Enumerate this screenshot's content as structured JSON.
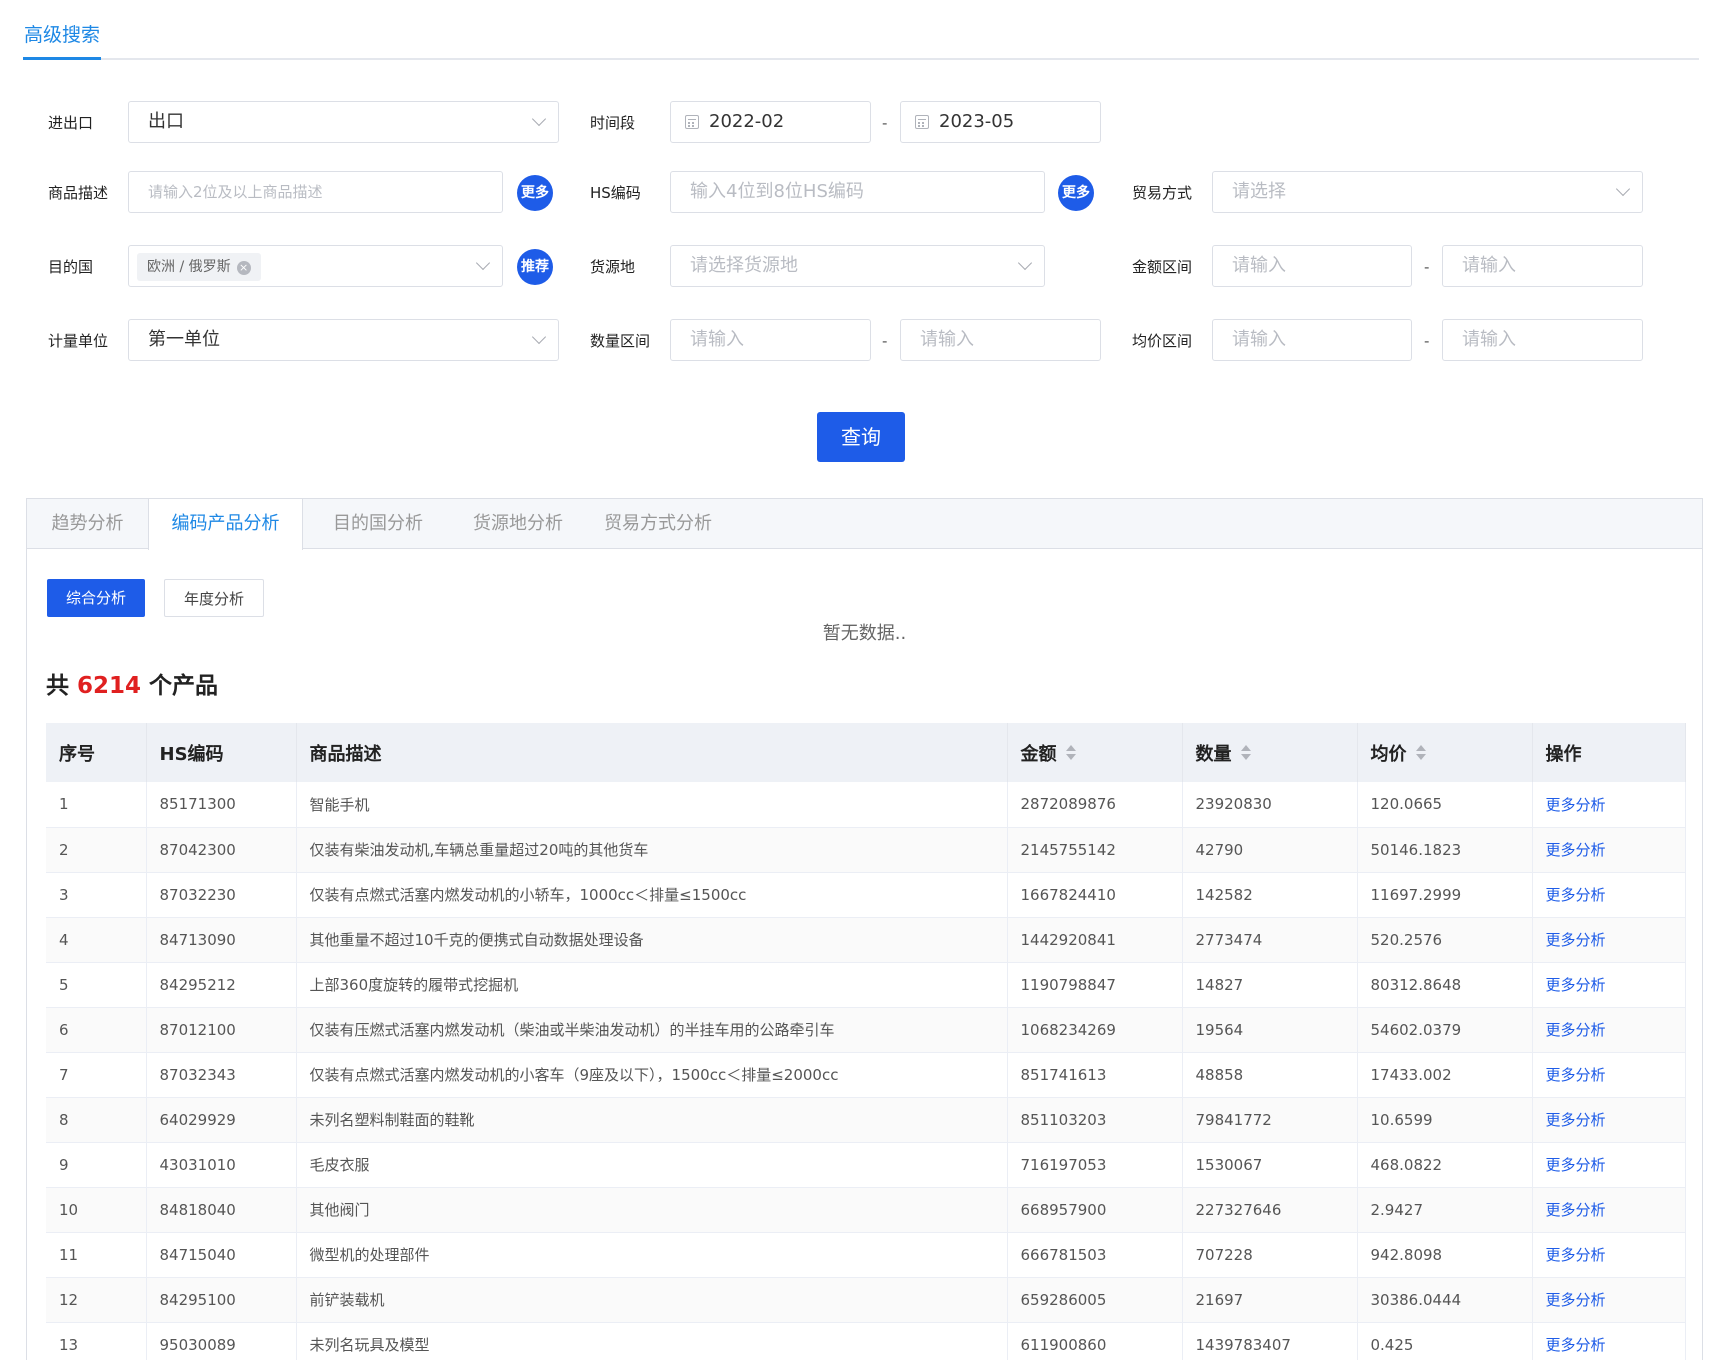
{
  "top_tab": "高级搜索",
  "form": {
    "import_export": {
      "label": "进出口",
      "value": "出口"
    },
    "period": {
      "label": "时间段",
      "start": "2022-02",
      "end": "2023-05",
      "sep": "-"
    },
    "product_desc": {
      "label": "商品描述",
      "placeholder": "请输入2位及以上商品描述",
      "more": "更多"
    },
    "hs_code": {
      "label": "HS编码",
      "placeholder": "输入4位到8位HS编码",
      "more": "更多"
    },
    "trade_mode": {
      "label": "贸易方式",
      "placeholder": "请选择"
    },
    "destination": {
      "label": "目的国",
      "tag": "欧洲 / 俄罗斯",
      "recommend": "推荐"
    },
    "origin": {
      "label": "货源地",
      "placeholder": "请选择货源地"
    },
    "amount_range": {
      "label": "金额区间",
      "placeholder_min": "请输入",
      "placeholder_max": "请输入",
      "sep": "-"
    },
    "unit": {
      "label": "计量单位",
      "value": "第一单位"
    },
    "qty_range": {
      "label": "数量区间",
      "placeholder_min": "请输入",
      "placeholder_max": "请输入",
      "sep": "-"
    },
    "price_range": {
      "label": "均价区间",
      "placeholder_min": "请输入",
      "placeholder_max": "请输入",
      "sep": "-"
    },
    "query_button": "查询"
  },
  "tabs": [
    "趋势分析",
    "编码产品分析",
    "目的国分析",
    "货源地分析",
    "贸易方式分析"
  ],
  "active_tab": "编码产品分析",
  "sub_buttons": {
    "comprehensive": "综合分析",
    "yearly": "年度分析"
  },
  "no_data": "暂无数据..",
  "summary": {
    "prefix": "共",
    "count": "6214",
    "suffix": "个产品"
  },
  "table": {
    "headers": [
      "序号",
      "HS编码",
      "商品描述",
      "金额",
      "数量",
      "均价",
      "操作"
    ],
    "rows": [
      [
        "1",
        "85171300",
        "智能手机",
        "2872089876",
        "23920830",
        "120.0665",
        "更多分析"
      ],
      [
        "2",
        "87042300",
        "仅装有柴油发动机,车辆总重量超过20吨的其他货车",
        "2145755142",
        "42790",
        "50146.1823",
        "更多分析"
      ],
      [
        "3",
        "87032230",
        "仅装有点燃式活塞内燃发动机的小轿车，1000cc＜排量≤1500cc",
        "1667824410",
        "142582",
        "11697.2999",
        "更多分析"
      ],
      [
        "4",
        "84713090",
        "其他重量不超过10千克的便携式自动数据处理设备",
        "1442920841",
        "2773474",
        "520.2576",
        "更多分析"
      ],
      [
        "5",
        "84295212",
        "上部360度旋转的履带式挖掘机",
        "1190798847",
        "14827",
        "80312.8648",
        "更多分析"
      ],
      [
        "6",
        "87012100",
        "仅装有压燃式活塞内燃发动机（柴油或半柴油发动机）的半挂车用的公路牵引车",
        "1068234269",
        "19564",
        "54602.0379",
        "更多分析"
      ],
      [
        "7",
        "87032343",
        "仅装有点燃式活塞内燃发动机的小客车（9座及以下），1500cc＜排量≤2000cc",
        "851741613",
        "48858",
        "17433.002",
        "更多分析"
      ],
      [
        "8",
        "64029929",
        "未列名塑料制鞋面的鞋靴",
        "851103203",
        "79841772",
        "10.6599",
        "更多分析"
      ],
      [
        "9",
        "43031010",
        "毛皮衣服",
        "716197053",
        "1530067",
        "468.0822",
        "更多分析"
      ],
      [
        "10",
        "84818040",
        "其他阀门",
        "668957900",
        "227327646",
        "2.9427",
        "更多分析"
      ],
      [
        "11",
        "84715040",
        "微型机的处理部件",
        "666781503",
        "707228",
        "942.8098",
        "更多分析"
      ],
      [
        "12",
        "84295100",
        "前铲装载机",
        "659286005",
        "21697",
        "30386.0444",
        "更多分析"
      ],
      [
        "13",
        "95030089",
        "未列名玩具及模型",
        "611900860",
        "1439783407",
        "0.425",
        "更多分析"
      ]
    ]
  }
}
